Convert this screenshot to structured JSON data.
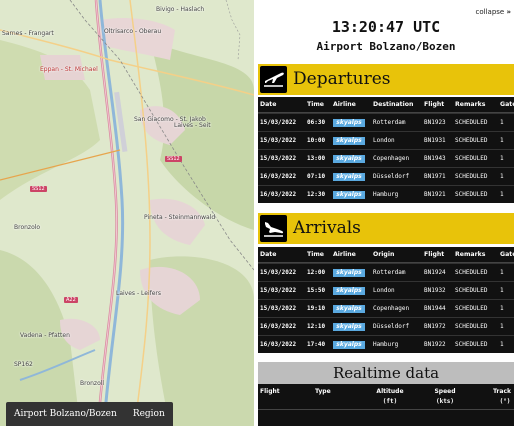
{
  "map": {
    "labels": {
      "l1": "Sarnes - Frangart",
      "l2": "Eppan - St. Michael",
      "l3": "Oltrisarco - Oberau",
      "l4": "Bivigo - Haslach",
      "l5": "San Giacomo - St. Jakob",
      "l6": "Laives - Seit",
      "l7": "Pineta - Steinmannwald",
      "l8": "Laives - Leifers",
      "l9": "Vadena - Pfatten",
      "l10": "Bronzoll",
      "l11": "Bronzolo",
      "l12": "A22",
      "l13": "SS12",
      "l14": "SS12",
      "l15": "SP162"
    },
    "tabs": [
      "Airport Bolzano/Bozen",
      "Region"
    ]
  },
  "header": {
    "time": "13:20:47 UTC",
    "airport": "Airport Bolzano/Bozen",
    "collapse": "collapse"
  },
  "departures": {
    "title": "Departures",
    "columns": [
      "Date",
      "Time",
      "Airline",
      "Destination",
      "Flight",
      "Remarks",
      "Gate"
    ],
    "rows": [
      {
        "date": "15/03/2022",
        "time": "06:30",
        "airline": "skyalps",
        "place": "Rotterdam",
        "flight": "BN1923",
        "remarks": "SCHEDULED",
        "gate": "1"
      },
      {
        "date": "15/03/2022",
        "time": "10:00",
        "airline": "skyalps",
        "place": "London",
        "flight": "BN1931",
        "remarks": "SCHEDULED",
        "gate": "1"
      },
      {
        "date": "15/03/2022",
        "time": "13:00",
        "airline": "skyalps",
        "place": "Copenhagen",
        "flight": "BN1943",
        "remarks": "SCHEDULED",
        "gate": "1"
      },
      {
        "date": "16/03/2022",
        "time": "07:10",
        "airline": "skyalps",
        "place": "Düsseldorf",
        "flight": "BN1971",
        "remarks": "SCHEDULED",
        "gate": "1"
      },
      {
        "date": "16/03/2022",
        "time": "12:30",
        "airline": "skyalps",
        "place": "Hamburg",
        "flight": "BN1921",
        "remarks": "SCHEDULED",
        "gate": "1"
      }
    ]
  },
  "arrivals": {
    "title": "Arrivals",
    "columns": [
      "Date",
      "Time",
      "Airline",
      "Origin",
      "Flight",
      "Remarks",
      "Gate"
    ],
    "rows": [
      {
        "date": "15/03/2022",
        "time": "12:00",
        "airline": "skyalps",
        "place": "Rotterdam",
        "flight": "BN1924",
        "remarks": "SCHEDULED",
        "gate": "1"
      },
      {
        "date": "15/03/2022",
        "time": "15:50",
        "airline": "skyalps",
        "place": "London",
        "flight": "BN1932",
        "remarks": "SCHEDULED",
        "gate": "1"
      },
      {
        "date": "15/03/2022",
        "time": "19:10",
        "airline": "skyalps",
        "place": "Copenhagen",
        "flight": "BN1944",
        "remarks": "SCHEDULED",
        "gate": "1"
      },
      {
        "date": "16/03/2022",
        "time": "12:10",
        "airline": "skyalps",
        "place": "Düsseldorf",
        "flight": "BN1972",
        "remarks": "SCHEDULED",
        "gate": "1"
      },
      {
        "date": "16/03/2022",
        "time": "17:40",
        "airline": "skyalps",
        "place": "Hamburg",
        "flight": "BN1922",
        "remarks": "SCHEDULED",
        "gate": "1"
      }
    ]
  },
  "realtime": {
    "title": "Realtime data",
    "columns": {
      "flight": "Flight",
      "type": "Type",
      "altitude": "Altitude",
      "altitude_unit": "(ft)",
      "speed": "Speed",
      "speed_unit": "(kts)",
      "track": "Track",
      "track_unit": "(°)"
    }
  },
  "colors": {
    "section_accent": "#e8c30a",
    "table_bg": "#111111",
    "airline_logo": "#5aa9e0",
    "realtime_bar": "#bdbdbd"
  }
}
